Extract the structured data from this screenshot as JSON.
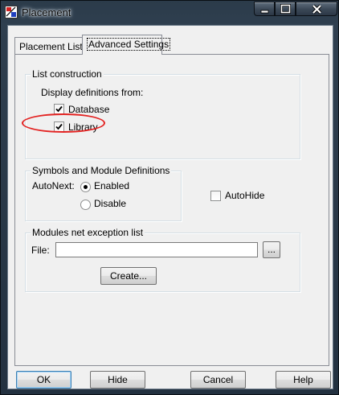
{
  "window": {
    "title": "Placement",
    "app_icon": "placement-app-icon",
    "caption_buttons": [
      "minimize-icon",
      "maximize-icon",
      "close-icon"
    ]
  },
  "tabs": [
    {
      "label": "Placement List",
      "active": false
    },
    {
      "label": "Advanced Settings",
      "active": true
    }
  ],
  "list_construction": {
    "title": "List construction",
    "subtitle": "Display definitions from:",
    "database": {
      "label": "Database",
      "checked": true
    },
    "library": {
      "label": "Library",
      "checked": true
    }
  },
  "symbols": {
    "title": "Symbols and Module Definitions",
    "autonext_label": "AutoNext:",
    "options": [
      {
        "label": "Enabled",
        "selected": true
      },
      {
        "label": "Disable",
        "selected": false
      }
    ]
  },
  "autohide": {
    "label": "AutoHide",
    "checked": false
  },
  "modules": {
    "title": "Modules net exception list",
    "file_label": "File:",
    "file_value": "",
    "browse_label": "...",
    "create_label": "Create..."
  },
  "buttons": {
    "ok": "OK",
    "hide": "Hide",
    "cancel": "Cancel",
    "help": "Help"
  },
  "colors": {
    "annotation": "#e32322"
  }
}
